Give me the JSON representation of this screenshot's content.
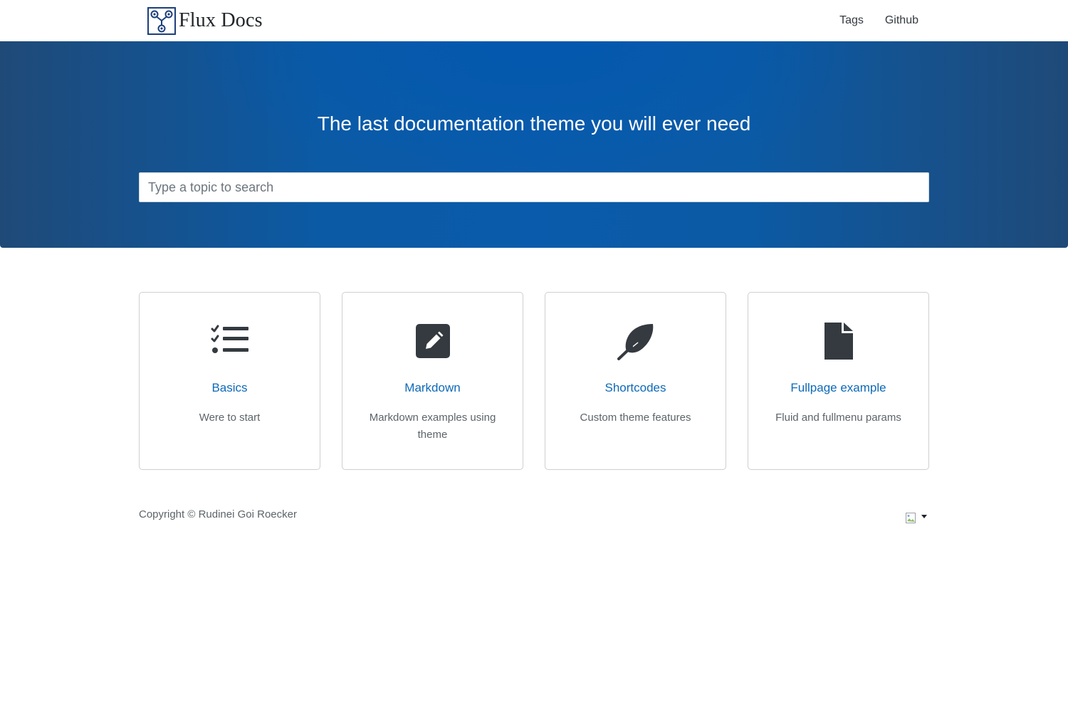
{
  "navbar": {
    "brand_name": "Flux Docs",
    "links": [
      {
        "label": "Tags"
      },
      {
        "label": "Github"
      }
    ]
  },
  "hero": {
    "title": "The last documentation theme you will ever need",
    "search_placeholder": "Type a topic to search",
    "search_value": "",
    "colors": {
      "center": "#0358ae",
      "edge": "#1f4a78"
    }
  },
  "cards": [
    {
      "icon": "tasks-icon",
      "title": "Basics",
      "description": "Were to start"
    },
    {
      "icon": "edit-icon",
      "title": "Markdown",
      "description": "Markdown examples using theme"
    },
    {
      "icon": "feather-icon",
      "title": "Shortcodes",
      "description": "Custom theme features"
    },
    {
      "icon": "file-icon",
      "title": "Fullpage example",
      "description": "Fluid and fullmenu params"
    }
  ],
  "footer": {
    "copyright": "Copyright © Rudinei Goi Roecker",
    "language_switch_icon": "flag-icon"
  },
  "colors": {
    "link": "#0d6ab8",
    "icon": "#343a40",
    "text_muted": "#5d6469"
  }
}
